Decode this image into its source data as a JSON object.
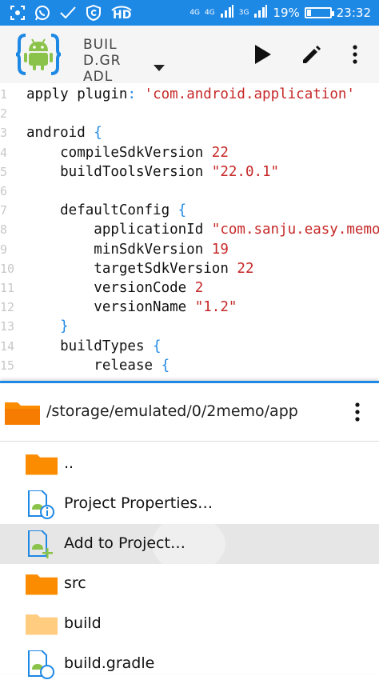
{
  "status_bar": {
    "network_small_1": "4G",
    "network_small_2": "4G",
    "network_small_3": "3G",
    "battery": "19%",
    "battery_level": 0.19,
    "time": "23:32",
    "hd": "HD",
    "icons": [
      "screenshot-icon",
      "whatsapp-icon",
      "check-icon",
      "cloud-c-icon",
      "hd-icon",
      "signal-icon",
      "battery-icon"
    ]
  },
  "app_bar": {
    "title": "BUILD.GRADL",
    "icons": [
      "android-logo-icon",
      "dropdown-arrow-icon",
      "play-icon",
      "edit-pencil-icon",
      "more-vert-icon"
    ]
  },
  "editor": {
    "lines": [
      {
        "n": "1",
        "tokens": [
          [
            "apply plugin",
            ""
          ],
          [
            ":",
            "colon"
          ],
          [
            " ",
            ""
          ],
          [
            "'com.android.application'",
            "str"
          ]
        ]
      },
      {
        "n": "2",
        "tokens": []
      },
      {
        "n": "3",
        "tokens": [
          [
            "android ",
            ""
          ],
          [
            "{",
            "brace"
          ]
        ]
      },
      {
        "n": "4",
        "tokens": [
          [
            "    compileSdkVersion ",
            ""
          ],
          [
            "22",
            "num"
          ]
        ]
      },
      {
        "n": "5",
        "tokens": [
          [
            "    buildToolsVersion ",
            ""
          ],
          [
            "\"22.0.1\"",
            "str"
          ]
        ]
      },
      {
        "n": "6",
        "tokens": []
      },
      {
        "n": "7",
        "tokens": [
          [
            "    defaultConfig ",
            ""
          ],
          [
            "{",
            "brace"
          ]
        ]
      },
      {
        "n": "8",
        "tokens": [
          [
            "        applicationId ",
            ""
          ],
          [
            "\"com.sanju.easy.memo\"",
            "str"
          ]
        ]
      },
      {
        "n": "9",
        "tokens": [
          [
            "        minSdkVersion ",
            ""
          ],
          [
            "19",
            "num"
          ]
        ]
      },
      {
        "n": "10",
        "tokens": [
          [
            "        targetSdkVersion ",
            ""
          ],
          [
            "22",
            "num"
          ]
        ]
      },
      {
        "n": "11",
        "tokens": [
          [
            "        versionCode ",
            ""
          ],
          [
            "2",
            "num"
          ]
        ]
      },
      {
        "n": "12",
        "tokens": [
          [
            "        versionName ",
            ""
          ],
          [
            "\"1.2\"",
            "str"
          ]
        ]
      },
      {
        "n": "13",
        "tokens": [
          [
            "    ",
            ""
          ],
          [
            "}",
            "brace"
          ]
        ]
      },
      {
        "n": "14",
        "tokens": [
          [
            "    buildTypes ",
            ""
          ],
          [
            "{",
            "brace"
          ]
        ]
      },
      {
        "n": "15",
        "tokens": [
          [
            "        release ",
            ""
          ],
          [
            "{",
            "brace"
          ]
        ]
      }
    ]
  },
  "sheet": {
    "path": "/storage/emulated/0/2memo/app",
    "items": [
      {
        "label": "..",
        "icon": "folder-icon"
      },
      {
        "label": "Project Properties…",
        "icon": "project-properties-icon"
      },
      {
        "label": "Add to Project…",
        "icon": "add-to-project-icon"
      },
      {
        "label": "src",
        "icon": "folder-icon"
      },
      {
        "label": "build",
        "icon": "folder-light-icon"
      },
      {
        "label": "build.gradle",
        "icon": "gradle-file-icon"
      }
    ]
  },
  "colors": {
    "accent": "#1e88e5",
    "folder": "#fb8c00",
    "folder_light": "#ffcc80",
    "android_green": "#8bc34a",
    "string": "#c62828"
  }
}
